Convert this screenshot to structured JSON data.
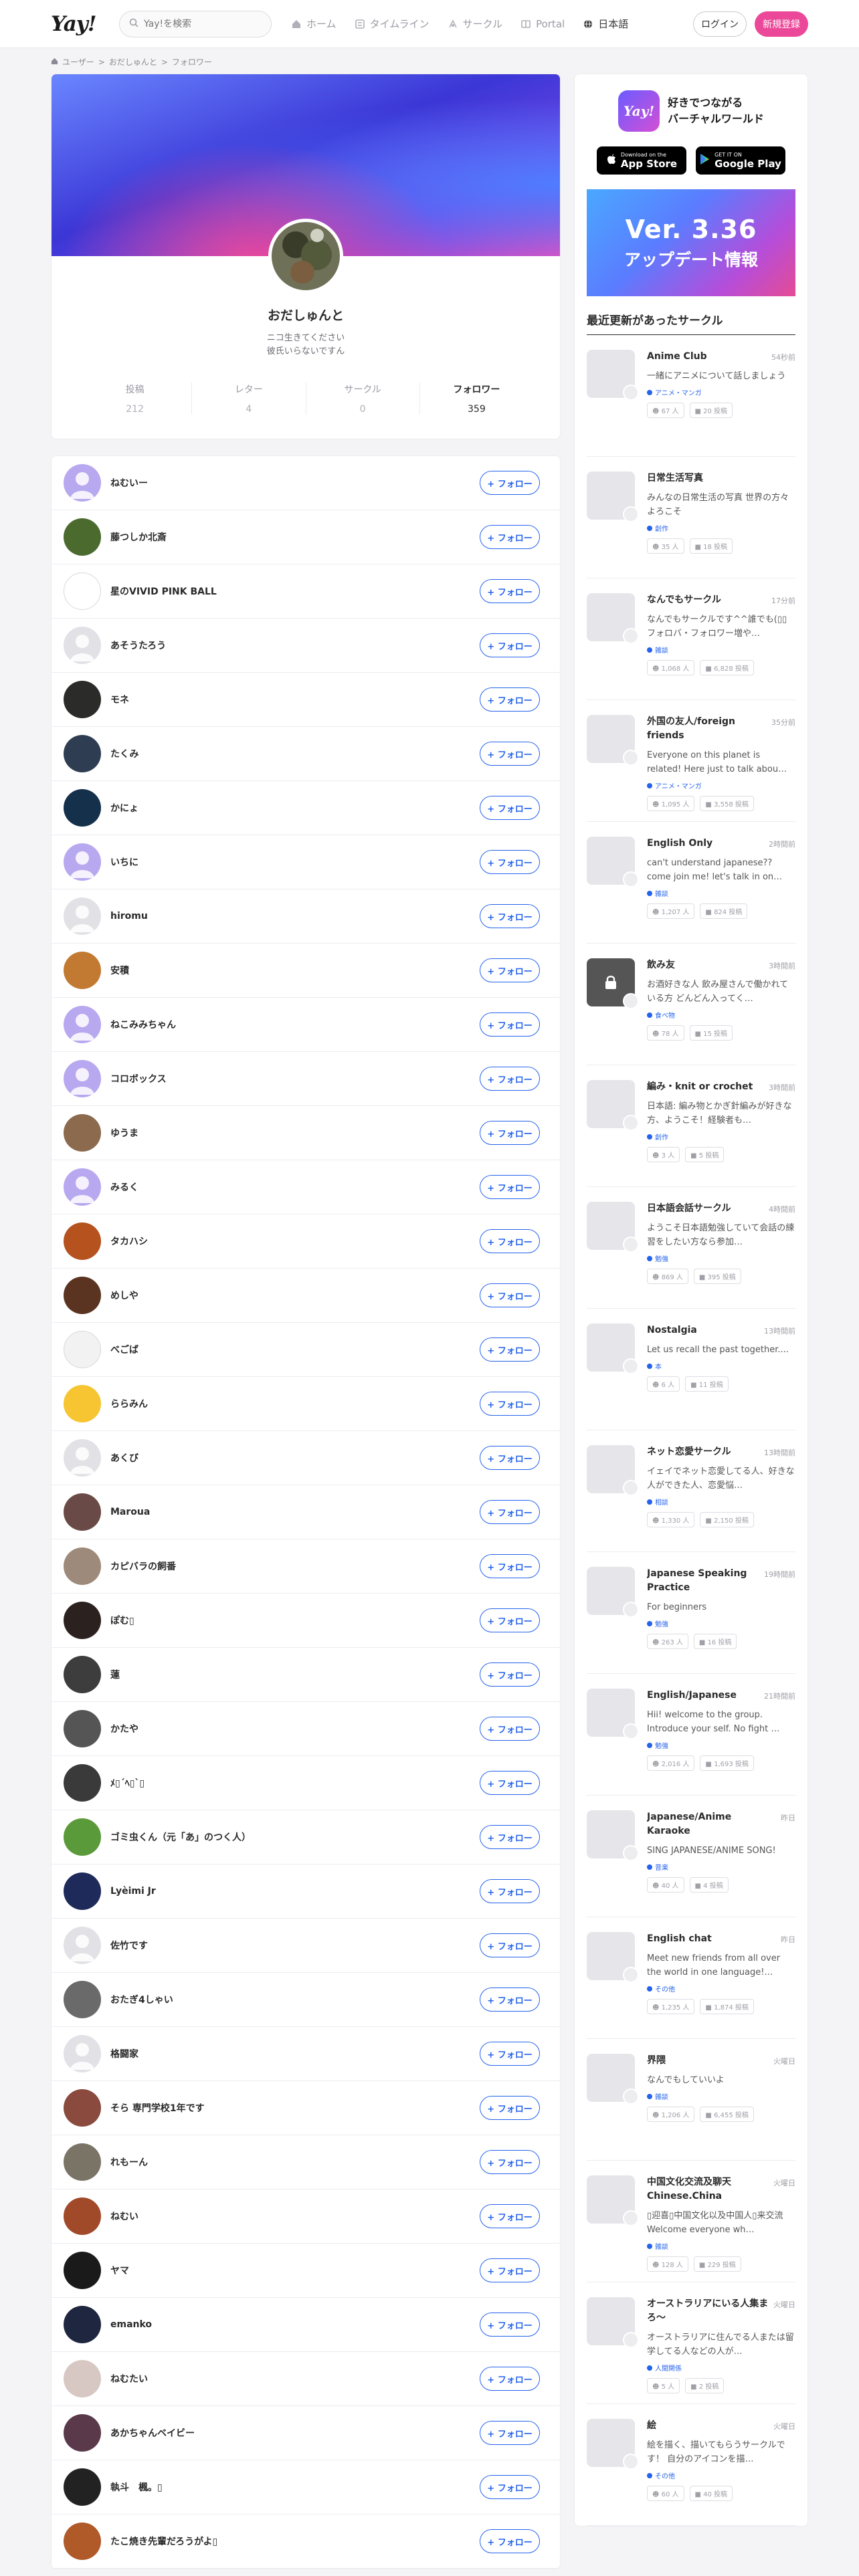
{
  "header": {
    "logo": "Yay!",
    "search_placeholder": "Yay!を検索",
    "nav": [
      {
        "label": "ホーム",
        "icon": "home-icon"
      },
      {
        "label": "タイムライン",
        "icon": "timeline-icon"
      },
      {
        "label": "サークル",
        "icon": "circle-icon"
      },
      {
        "label": "Portal",
        "icon": "portal-icon"
      },
      {
        "label": "日本語",
        "icon": "globe-icon"
      }
    ],
    "login": "ログイン",
    "signup": "新規登録"
  },
  "breadcrumb": [
    "ユーザー",
    "おだしゅんと",
    "フォロワー"
  ],
  "profile": {
    "name": "おだしゅんと",
    "bio_line1": "ニコ生きてください",
    "bio_line2": "彼氏いらないですん",
    "stats": [
      {
        "label": "投稿",
        "value": "212"
      },
      {
        "label": "レター",
        "value": "4"
      },
      {
        "label": "サークル",
        "value": "0"
      },
      {
        "label": "フォロワー",
        "value": "359"
      }
    ]
  },
  "follow_label": "+ フォロー",
  "followers": [
    {
      "name": "ねむいー",
      "color": "#b8a8f0"
    },
    {
      "name": "藤つしか北斎",
      "color": "#4a6a2e"
    },
    {
      "name": "星のVIVID PINK BALL",
      "color": "#ffffff"
    },
    {
      "name": "あそうたろう",
      "color": "#e2e2e6"
    },
    {
      "name": "モネ",
      "color": "#2b2c2a"
    },
    {
      "name": "たくみ",
      "color": "#2f3d52"
    },
    {
      "name": "かにょ",
      "color": "#15304a"
    },
    {
      "name": "いちに",
      "color": "#b8a8f0"
    },
    {
      "name": "hiromu",
      "color": "#e2e2e6"
    },
    {
      "name": "安積",
      "color": "#c27a33"
    },
    {
      "name": "ねこみみちゃん",
      "color": "#b8a8f0"
    },
    {
      "name": "コロボックス",
      "color": "#b8a8f0"
    },
    {
      "name": "ゆうま",
      "color": "#8b6a4e"
    },
    {
      "name": "みるく",
      "color": "#b8a8f0"
    },
    {
      "name": "タカハシ",
      "color": "#b5521e"
    },
    {
      "name": "めしや",
      "color": "#5a3420"
    },
    {
      "name": "べごば",
      "color": "#f2f2f2"
    },
    {
      "name": "ららみん",
      "color": "#f6c531"
    },
    {
      "name": "あくび",
      "color": "#e2e2e6"
    },
    {
      "name": "Maroua",
      "color": "#6a4a46"
    },
    {
      "name": "カピバラの飼番",
      "color": "#9d8a7a"
    },
    {
      "name": "ぽむ▯",
      "color": "#2b2220"
    },
    {
      "name": "蓮",
      "color": "#3d3d3d"
    },
    {
      "name": "かたや",
      "color": "#555555"
    },
    {
      "name": "ﾒ▯´ﾍ▯`▯",
      "color": "#3a3a3a"
    },
    {
      "name": "ゴミ虫くん（元「あ」のつく人）",
      "color": "#5b9a3a"
    },
    {
      "name": "Lyèimi Jr",
      "color": "#1e2a5a"
    },
    {
      "name": "佐竹です",
      "color": "#e2e2e6"
    },
    {
      "name": "おたぎ4しゃい",
      "color": "#6a6a6a"
    },
    {
      "name": "格闘家",
      "color": "#e2e2e6"
    },
    {
      "name": "そら 専門学校1年です",
      "color": "#8a4a3e"
    },
    {
      "name": "れもーん",
      "color": "#7a7466"
    },
    {
      "name": "ねむい",
      "color": "#a04a2a"
    },
    {
      "name": "ヤマ",
      "color": "#1a1a1a"
    },
    {
      "name": "emanko",
      "color": "#1f2740"
    },
    {
      "name": "ねむたい",
      "color": "#d8c8c4"
    },
    {
      "name": "あかちゃんベイビー",
      "color": "#5a3a4a"
    },
    {
      "name": "執斗　楓。▯",
      "color": "#222222"
    },
    {
      "name": "たこ焼き先輩だろうがよ▯",
      "color": "#b05a2a"
    }
  ],
  "sidebar": {
    "promo_line1": "好きでつながる",
    "promo_line2": "バーチャルワールド",
    "app_icon_text": "Yay!",
    "appstore_small": "Download on the",
    "appstore": "App Store",
    "googleplay_small": "GET IT ON",
    "googleplay": "Google Play",
    "banner_version": "Ver. 3.36",
    "banner_sub": "アップデート情報",
    "section_title": "最近更新があったサークル",
    "circles": [
      {
        "name": "Anime Club",
        "time": "54秒前",
        "desc": "一緒にアニメについて話しましょう",
        "category": "アニメ・マンガ",
        "members": "67 人",
        "posts": "20 投稿",
        "locked": false
      },
      {
        "name": "日常生活写真",
        "time": "",
        "desc": "みんなの日常生活の写真 世界の方々よろこそ",
        "category": "創作",
        "members": "35 人",
        "posts": "18 投稿",
        "locked": false
      },
      {
        "name": "なんでもサークル",
        "time": "17分前",
        "desc": "なんでもサークルです^^誰でも(▯▯フォロバ・フォロワー増や…",
        "category": "雑談",
        "members": "1,068 人",
        "posts": "6,828 投稿",
        "locked": false
      },
      {
        "name": "外国の友人/foreign friends",
        "time": "35分前",
        "desc": "Everyone on this planet is related! Here just to talk abou…",
        "category": "アニメ・マンガ",
        "members": "1,095 人",
        "posts": "3,558 投稿",
        "locked": false
      },
      {
        "name": "English Only",
        "time": "2時間前",
        "desc": "can't understand japanese?? come join me! let's talk in on…",
        "category": "雑談",
        "members": "1,207 人",
        "posts": "824 投稿",
        "locked": false
      },
      {
        "name": "飲み友",
        "time": "3時間前",
        "desc": "お酒好きな人 飲み屋さんで働かれている方 どんどん入ってく…",
        "category": "食べ物",
        "members": "78 人",
        "posts": "15 投稿",
        "locked": true
      },
      {
        "name": "編み・knit or crochet",
        "time": "3時間前",
        "desc": "日本語: 編み物とかぎ針編みが好きな方、ようこそ！経験者も…",
        "category": "創作",
        "members": "3 人",
        "posts": "5 投稿",
        "locked": false
      },
      {
        "name": "日本語会話サークル",
        "time": "4時間前",
        "desc": "ようこそ日本語勉強していて会話の練習をしたい方なら参加…",
        "category": "勉強",
        "members": "869 人",
        "posts": "395 投稿",
        "locked": false
      },
      {
        "name": "Nostalgia",
        "time": "13時間前",
        "desc": "Let us recall the past together....",
        "category": "本",
        "members": "6 人",
        "posts": "11 投稿",
        "locked": false
      },
      {
        "name": "ネット恋愛サークル",
        "time": "13時間前",
        "desc": "イェイでネット恋愛してる人、好きな人ができた人、恋愛悩…",
        "category": "相談",
        "members": "1,330 人",
        "posts": "2,150 投稿",
        "locked": false
      },
      {
        "name": "Japanese Speaking Practice",
        "time": "19時間前",
        "desc": "For beginners",
        "category": "勉強",
        "members": "263 人",
        "posts": "16 投稿",
        "locked": false
      },
      {
        "name": "English/Japanese",
        "time": "21時間前",
        "desc": "Hii! welcome to the group. Introduce your self. No fight …",
        "category": "勉強",
        "members": "2,016 人",
        "posts": "1,693 投稿",
        "locked": false
      },
      {
        "name": "Japanese/Anime Karaoke",
        "time": "昨日",
        "desc": "SING JAPANESE/ANIME SONG!",
        "category": "音楽",
        "members": "40 人",
        "posts": "4 投稿",
        "locked": false
      },
      {
        "name": "English chat",
        "time": "昨日",
        "desc": "Meet new friends from all over the world in one language!…",
        "category": "その他",
        "members": "1,235 人",
        "posts": "1,874 投稿",
        "locked": false
      },
      {
        "name": "界隈",
        "time": "火曜日",
        "desc": "なんでもしていいよ",
        "category": "雑談",
        "members": "1,206 人",
        "posts": "6,455 投稿",
        "locked": false
      },
      {
        "name": "中国文化交流及聊天 Chinese.China",
        "time": "火曜日",
        "desc": "▯迎喜▯中国文化以及中国人▯来交流 Welcome everyone wh…",
        "category": "雑談",
        "members": "128 人",
        "posts": "229 投稿",
        "locked": false
      },
      {
        "name": "オーストラリアにいる人集まろ〜",
        "time": "火曜日",
        "desc": "オーストラリアに住んでる人または留学してる人などの人が…",
        "category": "人間関係",
        "members": "5 人",
        "posts": "2 投稿",
        "locked": false
      },
      {
        "name": "絵",
        "time": "火曜日",
        "desc": "絵を描く、描いてもらうサークルです！ 自分のアイコンを描…",
        "category": "その他",
        "members": "60 人",
        "posts": "40 投稿",
        "locked": false
      }
    ]
  },
  "colors": {
    "accent": "#2563eb",
    "signup": "#ec4899"
  }
}
